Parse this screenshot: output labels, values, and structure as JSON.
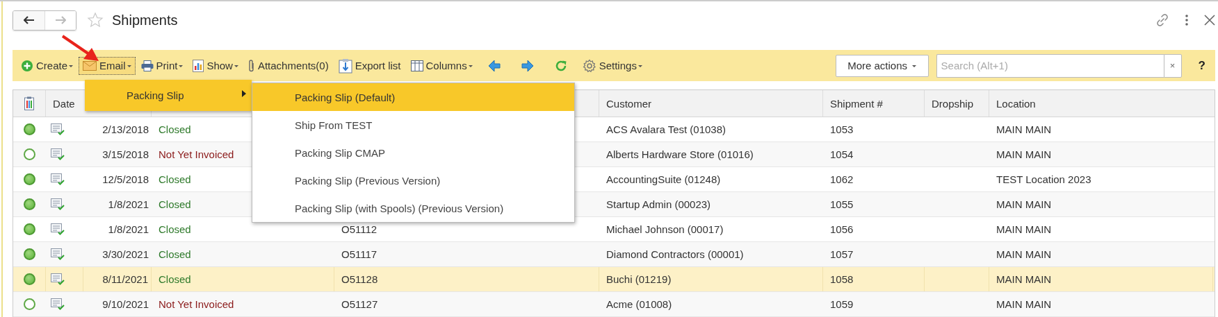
{
  "window": {
    "title": "Shipments",
    "starred": false
  },
  "toolbar": {
    "items": [
      {
        "label": "Create",
        "dropdown": true,
        "open": false
      },
      {
        "label": "Email",
        "dropdown": true,
        "open": true
      },
      {
        "label": "Print",
        "dropdown": true,
        "open": false
      },
      {
        "label": "Show",
        "dropdown": true,
        "open": false
      },
      {
        "label": "Attachments(0)",
        "dropdown": false,
        "open": false
      },
      {
        "label": "Export list",
        "dropdown": false,
        "open": false
      },
      {
        "label": "Columns",
        "dropdown": true,
        "open": false
      },
      {
        "dropdown": false,
        "open": false
      },
      {
        "dropdown": false,
        "open": false
      },
      {
        "dropdown": false,
        "open": false
      },
      {
        "label": "Settings",
        "dropdown": true,
        "open": false
      }
    ],
    "more_actions": "More actions",
    "search": {
      "placeholder": "Search (Alt+1)"
    },
    "clear": "×",
    "help": "?"
  },
  "email_menu": {
    "items": [
      {
        "label": "Packing Slip",
        "submenu": true,
        "selected": true
      }
    ]
  },
  "submenu": {
    "items": [
      {
        "label": "Packing Slip (Default)",
        "selected": true
      },
      {
        "label": "Ship From TEST",
        "selected": false
      },
      {
        "label": "Packing Slip CMAP",
        "selected": false
      },
      {
        "label": "Packing Slip (Previous Version)",
        "selected": false
      },
      {
        "label": "Packing Slip (with Spools) (Previous Version)",
        "selected": false
      }
    ]
  },
  "table": {
    "columns": [
      "Date",
      "Customer",
      "Shipment #",
      "Dropship",
      "Location"
    ],
    "rows": [
      {
        "posted": true,
        "date": "2/13/2018",
        "status": {
          "text": "Closed",
          "color": "#2f7a2b"
        },
        "customer": "ACS Avalara Test (01038)",
        "shipment": "1053",
        "location": "MAIN MAIN",
        "selected": false
      },
      {
        "posted": false,
        "date": "3/15/2018",
        "status": {
          "text": "Not Yet Invoiced",
          "color": "#8b1a1a"
        },
        "customer": "Alberts Hardware Store (01016)",
        "shipment": "1054",
        "location": "MAIN MAIN",
        "selected": false
      },
      {
        "posted": true,
        "date": "12/5/2018",
        "status": {
          "text": "Closed",
          "color": "#2f7a2b"
        },
        "customer": "AccountingSuite (01248)",
        "shipment": "1062",
        "location": "TEST Location 2023",
        "selected": false
      },
      {
        "posted": true,
        "date": "1/8/2021",
        "status": {
          "text": "Closed",
          "color": "#2f7a2b"
        },
        "customer": "Startup Admin (00023)",
        "shipment": "1055",
        "location": "MAIN MAIN",
        "selected": false
      },
      {
        "posted": true,
        "date": "1/8/2021",
        "status": {
          "text": "Closed",
          "color": "#2f7a2b"
        },
        "order": "O51112",
        "customer": "Michael Johnson (00017)",
        "shipment": "1056",
        "location": "MAIN MAIN",
        "selected": false
      },
      {
        "posted": true,
        "date": "3/30/2021",
        "status": {
          "text": "Closed",
          "color": "#2f7a2b"
        },
        "order": "O51117",
        "customer": "Diamond Contractors (00001)",
        "shipment": "1057",
        "location": "MAIN MAIN",
        "selected": false
      },
      {
        "posted": true,
        "date": "8/11/2021",
        "status": {
          "text": "Closed",
          "color": "#2f7a2b"
        },
        "order": "O51128",
        "customer": "Buchi (01219)",
        "shipment": "1058",
        "location": "MAIN MAIN",
        "selected": true
      },
      {
        "posted": false,
        "date": "9/10/2021",
        "status": {
          "text": "Not Yet Invoiced",
          "color": "#8b1a1a"
        },
        "order": "O51127",
        "customer": "Acme (01008)",
        "shipment": "1059",
        "location": "MAIN MAIN",
        "selected": false
      }
    ]
  }
}
